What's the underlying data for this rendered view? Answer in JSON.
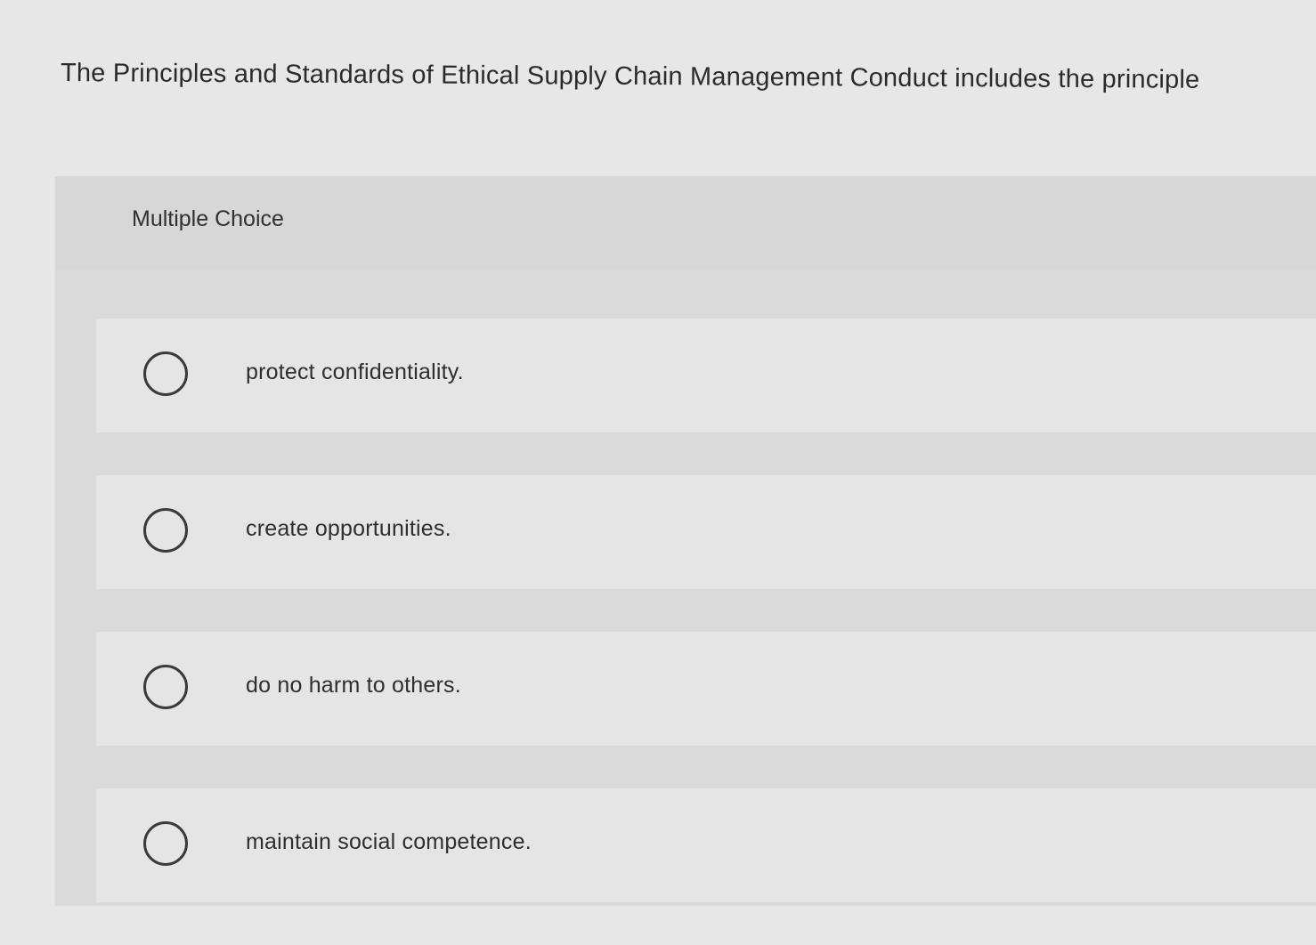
{
  "question": {
    "text": "The Principles and Standards of Ethical Supply Chain Management Conduct includes the principle"
  },
  "panel": {
    "title": "Multiple Choice"
  },
  "options": [
    {
      "label": "protect confidentiality."
    },
    {
      "label": "create opportunities."
    },
    {
      "label": "do no harm to others."
    },
    {
      "label": "maintain social competence."
    }
  ],
  "colors": {
    "background": "#e6e7e6",
    "panel": "#d9dad9",
    "option_row": "#e4e5e4",
    "text": "#2e2e30"
  }
}
